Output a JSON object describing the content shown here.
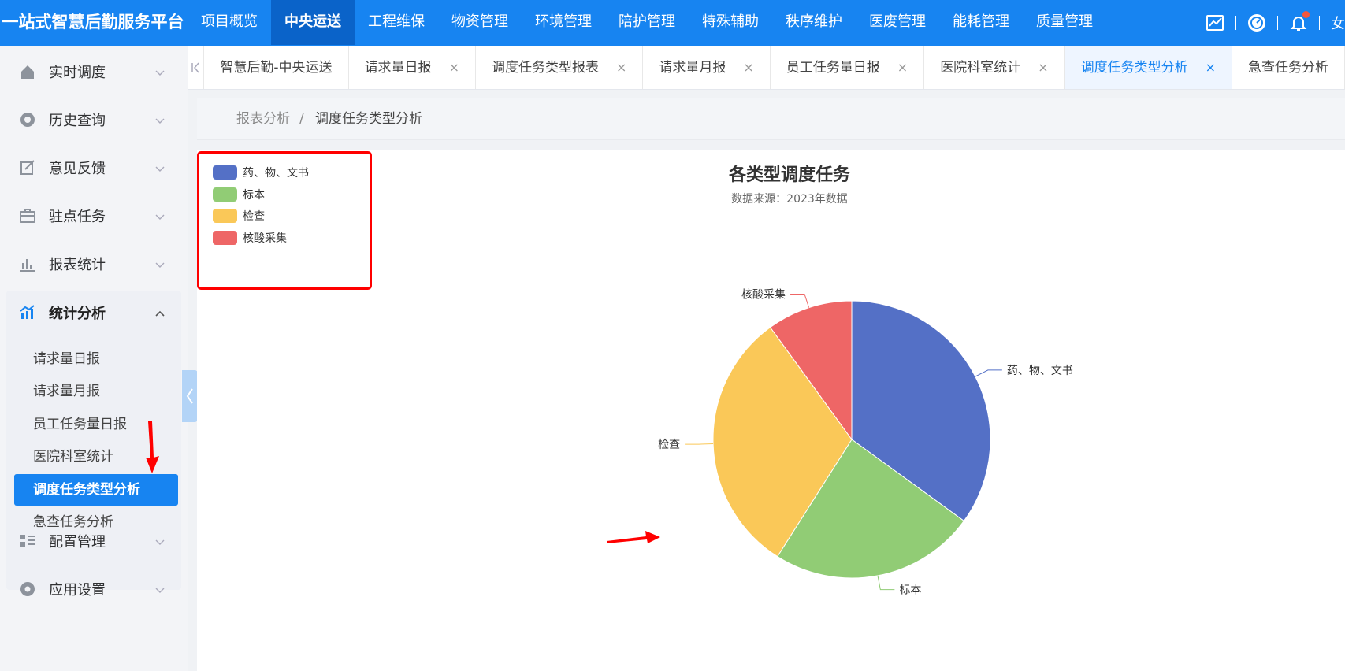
{
  "app": {
    "title": "一站式智慧后勤服务平台"
  },
  "topnav": {
    "items": [
      "项目概览",
      "中央运送",
      "工程维保",
      "物资管理",
      "环境管理",
      "陪护管理",
      "特殊辅助",
      "秩序维护",
      "医废管理",
      "能耗管理",
      "质量管理"
    ],
    "active_index": 1,
    "user_partial": "女"
  },
  "sidebar": {
    "items": [
      {
        "label": "实时调度",
        "icon": "house-icon"
      },
      {
        "label": "历史查询",
        "icon": "history-icon"
      },
      {
        "label": "意见反馈",
        "icon": "edit-icon"
      },
      {
        "label": "驻点任务",
        "icon": "briefcase-icon"
      },
      {
        "label": "报表统计",
        "icon": "bar-chart-icon"
      },
      {
        "label": "统计分析",
        "icon": "analytics-icon"
      },
      {
        "label": "配置管理",
        "icon": "list-icon"
      },
      {
        "label": "应用设置",
        "icon": "settings-icon"
      }
    ],
    "submenu": [
      "请求量日报",
      "请求量月报",
      "员工任务量日报",
      "医院科室统计",
      "调度任务类型分析",
      "急查任务分析"
    ],
    "submenu_active_index": 4
  },
  "tabs": {
    "items": [
      {
        "label": "智慧后勤-中央运送",
        "closable": false
      },
      {
        "label": "请求量日报",
        "closable": true
      },
      {
        "label": "调度任务类型报表",
        "closable": true
      },
      {
        "label": "请求量月报",
        "closable": true
      },
      {
        "label": "员工任务量日报",
        "closable": true
      },
      {
        "label": "医院科室统计",
        "closable": true
      },
      {
        "label": "调度任务类型分析",
        "closable": true
      },
      {
        "label": "急查任务分析",
        "closable": false
      }
    ],
    "active_index": 6,
    "close_glyph": "×"
  },
  "breadcrumb": {
    "parent": "报表分析",
    "separator": "/",
    "current": "调度任务类型分析"
  },
  "chart_data": {
    "type": "pie",
    "title": "各类型调度任务",
    "subtitle": "数据来源：2023年数据",
    "legend_position": "top-left",
    "slices": [
      {
        "name": "药、物、文书",
        "value": 35,
        "color": "#5470c6"
      },
      {
        "name": "标本",
        "value": 24,
        "color": "#91cc75"
      },
      {
        "name": "检查",
        "value": 31,
        "color": "#fac858"
      },
      {
        "name": "核酸采集",
        "value": 10,
        "color": "#ee6666"
      }
    ]
  },
  "colors": {
    "primary": "#1784f1",
    "annotation": "#ff0000"
  }
}
